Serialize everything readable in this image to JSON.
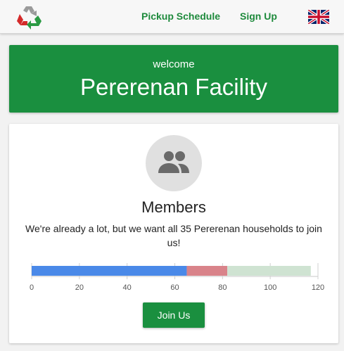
{
  "nav": {
    "logo_icon": "recycle-icon",
    "links": [
      {
        "label": "Pickup Schedule"
      },
      {
        "label": "Sign Up"
      }
    ],
    "language_icon": "uk-flag-icon"
  },
  "hero": {
    "welcome": "welcome",
    "title": "Pererenan Facility"
  },
  "members": {
    "icon": "group-icon",
    "title": "Members",
    "text": "We're already a lot, but we want all 35 Pererenan households to join us!",
    "join_label": "Join Us"
  },
  "colors": {
    "accent": "#1a8f3f",
    "bar_blue": "#4a89e8",
    "bar_red": "#d9838a",
    "bar_light_green": "#cfe3d2"
  },
  "chart_data": {
    "type": "bar",
    "orientation": "horizontal",
    "stacked": true,
    "series": [
      {
        "values": [
          65
        ],
        "color": "#4a89e8"
      },
      {
        "values": [
          17
        ],
        "color": "#d9838a"
      },
      {
        "values": [
          35
        ],
        "color": "#cfe3d2"
      }
    ],
    "xlim": [
      0,
      120
    ],
    "ticks": [
      0,
      20,
      40,
      60,
      80,
      100,
      120
    ],
    "grid": false
  }
}
